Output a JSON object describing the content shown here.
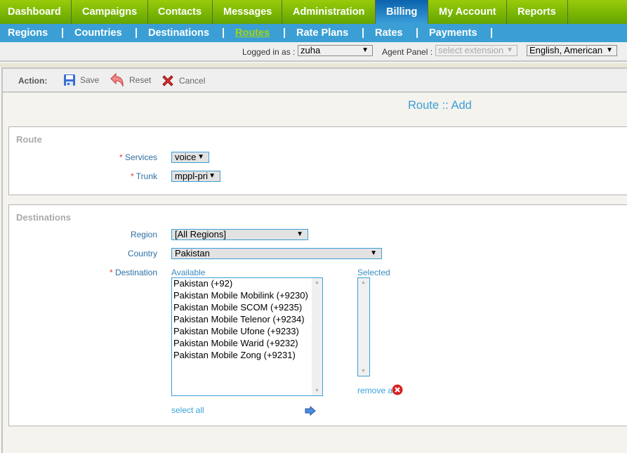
{
  "top_nav": {
    "tabs": [
      {
        "label": "Dashboard",
        "active": false
      },
      {
        "label": "Campaigns",
        "active": false
      },
      {
        "label": "Contacts",
        "active": false
      },
      {
        "label": "Messages",
        "active": false
      },
      {
        "label": "Administration",
        "active": false
      },
      {
        "label": "Billing",
        "active": true
      },
      {
        "label": "My Account",
        "active": false
      },
      {
        "label": "Reports",
        "active": false
      }
    ]
  },
  "sub_nav": {
    "items": [
      {
        "label": "Regions",
        "active": false
      },
      {
        "label": "Countries",
        "active": false
      },
      {
        "label": "Destinations",
        "active": false
      },
      {
        "label": "Routes",
        "active": true
      },
      {
        "label": "Rate Plans",
        "active": false
      },
      {
        "label": "Rates",
        "active": false
      },
      {
        "label": "Payments",
        "active": false
      }
    ],
    "separator": "|"
  },
  "login_bar": {
    "logged_in_label": "Logged in as :",
    "user": "zuha",
    "agent_panel_label": "Agent Panel :",
    "agent_panel_placeholder": "select extension",
    "language": "English, American"
  },
  "action_bar": {
    "label": "Action:",
    "save": "Save",
    "reset": "Reset",
    "cancel": "Cancel"
  },
  "page_title": "Route :: Add",
  "route_section": {
    "legend": "Route",
    "required_mark": "*",
    "services_label": "Services",
    "services_value": "voice",
    "trunk_label": "Trunk",
    "trunk_value": "mppl-pri"
  },
  "destinations_section": {
    "legend": "Destinations",
    "region_label": "Region",
    "region_value": "[All Regions]",
    "country_label": "Country",
    "country_value": "Pakistan",
    "destination_label": "Destination",
    "required_mark": "*",
    "available_label": "Available",
    "selected_label": "Selected",
    "available_options": [
      "Pakistan (+92)",
      "Pakistan Mobile Mobilink (+9230)",
      "Pakistan Mobile SCOM (+9235)",
      "Pakistan Mobile Telenor (+9234)",
      "Pakistan Mobile Ufone (+9233)",
      "Pakistan Mobile Warid (+9232)",
      "Pakistan Mobile Zong (+9231)"
    ],
    "selected_options": [],
    "select_all": "select all",
    "remove_all": "remove all"
  },
  "icons": {
    "dropdown_arrow": "▼",
    "scroll_up": "▲",
    "scroll_down": "▼"
  }
}
